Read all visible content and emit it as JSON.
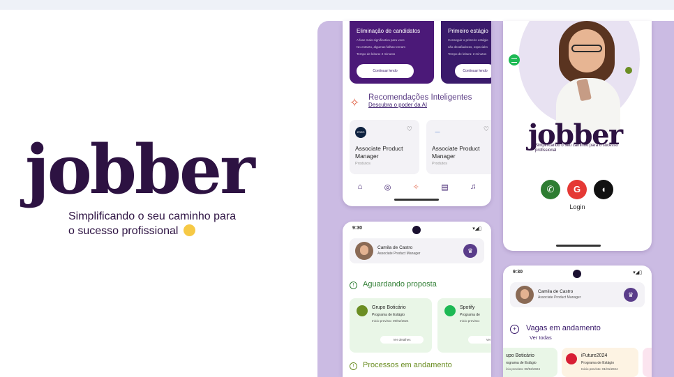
{
  "brand": {
    "logo": "jobber",
    "tagline_line1": "Simplificando o seu caminho para",
    "tagline_line2": "o sucesso profissional"
  },
  "phone1": {
    "promos": [
      {
        "title": "Eliminação de candidatos",
        "lines": [
          "A fase mais significativa para voce",
          "No entanto, algumas falhas tornam",
          "Tempo de leitura: 2 minutos"
        ],
        "button": "Continuar lendo"
      },
      {
        "title": "Primeiro estágio",
        "lines": [
          "Conseguir o primeiro estágio",
          "são desafiadoras, especialm",
          "Tempo de leitura: 2 minutos"
        ],
        "button": "Continuar lendo"
      }
    ],
    "recommendations": {
      "title": "Recomendações Inteligentes",
      "link": "Descubra o poder da AI"
    },
    "jobs": [
      {
        "logo": "ZOZO",
        "title": "Associate Product Manager",
        "area": "Produtos",
        "logo_icon": "company-logo"
      },
      {
        "logo": "—",
        "title": "Associate Product Manager",
        "area": "Produtos",
        "logo_icon": "company-logo"
      }
    ],
    "nav": [
      {
        "icon": "home-icon",
        "glyph": "⌂"
      },
      {
        "icon": "target-icon",
        "glyph": "◎"
      },
      {
        "icon": "sparkle-icon",
        "glyph": "✧"
      },
      {
        "icon": "document-icon",
        "glyph": "▤"
      },
      {
        "icon": "bell-icon",
        "glyph": "♫"
      }
    ]
  },
  "phone2": {
    "logo": "jobber",
    "tagline": "Simplificando o seu caminho para o sucesso profissional",
    "login": "Login",
    "social": [
      {
        "icon": "whatsapp-icon",
        "glyph": "✆"
      },
      {
        "icon": "google-icon",
        "glyph": "G"
      },
      {
        "icon": "apple-icon",
        "glyph": "◖"
      }
    ]
  },
  "phone3": {
    "time": "9:30",
    "signal": "▾◢▯",
    "profile_name": "Camila de Castro",
    "profile_role": "Associate Product Manager",
    "awaiting_title": "Aguardando proposta",
    "in_progress_title": "Processos em andamento",
    "cards": [
      {
        "company": "Grupo Boticário",
        "program": "Programa de Estágio",
        "date": "Inicio previsto: 09/02/2024",
        "button": "Ver detalhes",
        "color": "#6b8e23"
      },
      {
        "company": "Spotify",
        "program": "Programa de",
        "date": "Inicio previsto:",
        "button": "Ver d",
        "color": "#1db954"
      }
    ]
  },
  "phone4": {
    "time": "9:30",
    "signal": "▾◢▯",
    "profile_name": "Camila de Castro",
    "profile_role": "Associate Product Manager",
    "vagas_title": "Vagas em andamento",
    "vagas_link": "Ver todas",
    "cards": [
      {
        "company": "upo Boticário",
        "program": "rograma de Estágio",
        "date": "ício previsto: 09/02/2024"
      },
      {
        "company": "iFuture2024",
        "program": "Programa de Estágio",
        "date": "Inicio previsto: 01/01/2024"
      }
    ]
  },
  "colors": {
    "brand_purple": "#2d1242",
    "panel_lavender": "#cbbbe3",
    "accent_coral": "#e36a4f",
    "success_green": "#2e7d32"
  }
}
